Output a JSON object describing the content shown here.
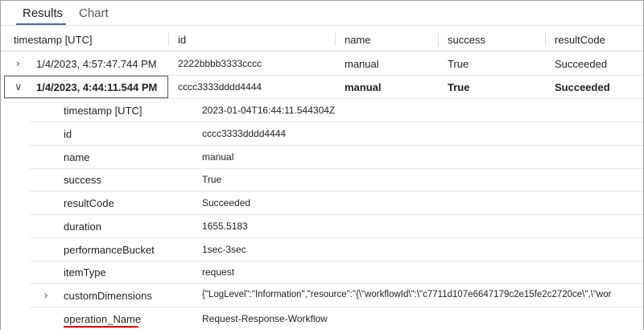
{
  "tabs": [
    {
      "label": "Results",
      "active": true
    },
    {
      "label": "Chart",
      "active": false
    }
  ],
  "columns": [
    "timestamp [UTC]",
    "id",
    "name",
    "success",
    "resultCode"
  ],
  "rows": [
    {
      "expanded": false,
      "timestamp": "1/4/2023, 4:57:47.744 PM",
      "id": "2222bbbb3333cccc",
      "name": "manual",
      "success": "True",
      "resultCode": "Succeeded"
    },
    {
      "expanded": true,
      "timestamp": "1/4/2023, 4:44:11.544 PM",
      "id": "cccc3333dddd4444",
      "name": "manual",
      "success": "True",
      "resultCode": "Succeeded"
    }
  ],
  "details": [
    {
      "key": "timestamp [UTC]",
      "value": "2023-01-04T16:44:11.544304Z"
    },
    {
      "key": "id",
      "value": "cccc3333dddd4444"
    },
    {
      "key": "name",
      "value": "manual"
    },
    {
      "key": "success",
      "value": "True"
    },
    {
      "key": "resultCode",
      "value": "Succeeded"
    },
    {
      "key": "duration",
      "value": "1655.5183"
    },
    {
      "key": "performanceBucket",
      "value": "1sec-3sec"
    },
    {
      "key": "itemType",
      "value": "request"
    },
    {
      "key": "customDimensions",
      "value": "{\"LogLevel\":\"Information\",\"resource\":\"{\\\"workflowId\\\":\\\"c7711d107e6647179c2e15fe2c2720ce\\\",\\\"wor",
      "expandable": true
    },
    {
      "key": "operation_Name",
      "value": "Request-Response-Workflow",
      "highlighted": true
    }
  ],
  "colors": {
    "tab_underline": "#4a6ea9",
    "highlight_underline": "#e00000"
  }
}
